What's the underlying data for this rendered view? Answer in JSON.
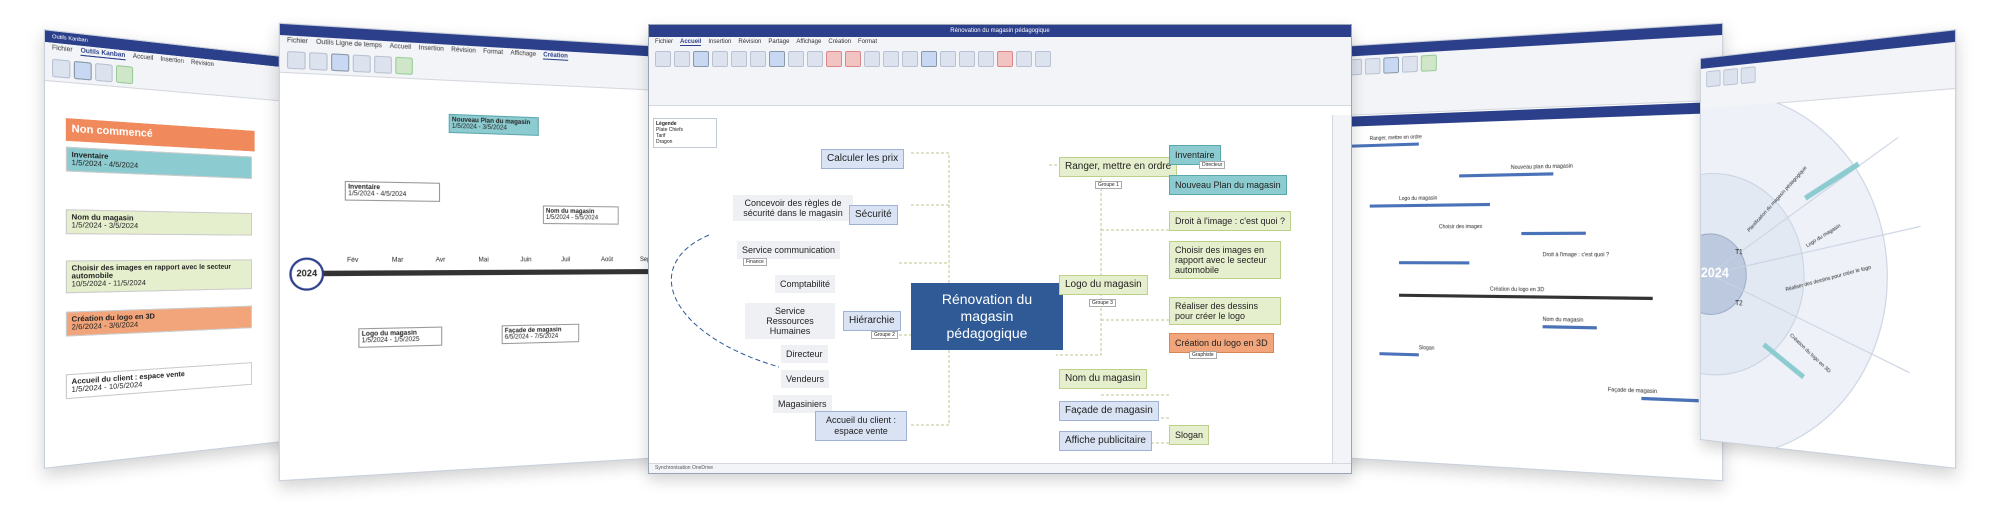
{
  "far_left": {
    "title": "Outils Kanban",
    "tabs": [
      "Fichier",
      "Outils Kanban",
      "Accueil",
      "Insertion",
      "Révision"
    ],
    "column_title": "Non commencé",
    "cards": [
      {
        "title": "Inventaire",
        "dates": "1/5/2024 - 4/5/2024"
      },
      {
        "title": "Nom du magasin",
        "dates": "1/5/2024 - 3/5/2024"
      },
      {
        "title": "Choisir des images en rapport avec le secteur automobile",
        "dates": "10/5/2024 - 11/5/2024"
      },
      {
        "title": "Création du logo en 3D",
        "dates": "2/6/2024 - 3/6/2024"
      },
      {
        "title": "Accueil du client : espace vente",
        "dates": "1/5/2024 - 10/5/2024"
      }
    ]
  },
  "left": {
    "tabs": [
      "Fichier",
      "Outils Ligne de temps",
      "Accueil",
      "Insertion",
      "Révision",
      "Format",
      "Affichage",
      "Création"
    ],
    "year": "2024",
    "months": [
      "Fév",
      "Mar",
      "Avr",
      "Mai",
      "Juin",
      "Juil",
      "Août",
      "Sep"
    ],
    "items": [
      {
        "title": "Nouveau Plan du magasin",
        "dates": "1/5/2024 - 3/5/2024"
      },
      {
        "title": "Inventaire",
        "dates": "1/5/2024 - 4/5/2024"
      },
      {
        "title": "Nom du magasin",
        "dates": "1/5/2024 - 5/5/2024"
      },
      {
        "title": "Logo du magasin",
        "dates": "1/5/2024 - 1/5/2025"
      },
      {
        "title": "Façade de magasin",
        "dates": "6/5/2024 - 7/5/2024"
      }
    ]
  },
  "center": {
    "title": "Rénovation du magasin pédagogique",
    "tabs": [
      "Fichier",
      "Accueil",
      "Insertion",
      "Révision",
      "Partage",
      "Affichage",
      "Création",
      "Format"
    ],
    "active_tab": "Accueil",
    "legend": {
      "title": "Légende",
      "items": [
        "Plate Chiefs",
        "Tarif",
        "Dragon"
      ]
    },
    "root": "Rénovation du magasin pédagogique",
    "left_nodes": [
      "Calculer les prix",
      "Concevoir des règles de sécurité dans le magasin",
      "Sécurité",
      "Service communication",
      "Comptabilité",
      "Service Ressources Humaines",
      "Hiérarchie",
      "Directeur",
      "Vendeurs",
      "Magasiniers",
      "Accueil du client : espace vente"
    ],
    "right_nodes": [
      "Ranger, mettre en ordre",
      "Inventaire",
      "Nouveau Plan du magasin",
      "Droit à l'image : c'est quoi ?",
      "Choisir des images en rapport avec le secteur automobile",
      "Logo du magasin",
      "Réaliser des dessins pour créer le logo",
      "Création du logo en 3D",
      "Nom du magasin",
      "Façade de magasin",
      "Affiche publicitaire",
      "Slogan"
    ],
    "tags": [
      "Groupe 1",
      "Groupe 2",
      "Groupe 3",
      "Finance",
      "Graphiste",
      "Directeur"
    ],
    "status": "Synchronisation OneDrive"
  },
  "right": {
    "tasks": [
      "Ranger, mettre en ordre",
      "Nouveau plan du magasin",
      "Logo du magasin",
      "Choisir des images",
      "Droit à l'image : c'est quoi ?",
      "Création du logo en 3D",
      "Nom du magasin",
      "Slogan",
      "Façade de magasin"
    ]
  },
  "far_right": {
    "year": "2024",
    "quarters": [
      "T1",
      "T2"
    ],
    "labels": [
      "Planification du magasin pédagogique",
      "Logo du magasin",
      "Réaliser des dessins pour créer le logo",
      "Création du logo en 3D"
    ]
  },
  "colors": {
    "accent": "#2b3f8a",
    "root": "#2f5a96",
    "orange": "#f2a57a",
    "teal": "#8ccbcf",
    "green": "#e6efcd"
  }
}
